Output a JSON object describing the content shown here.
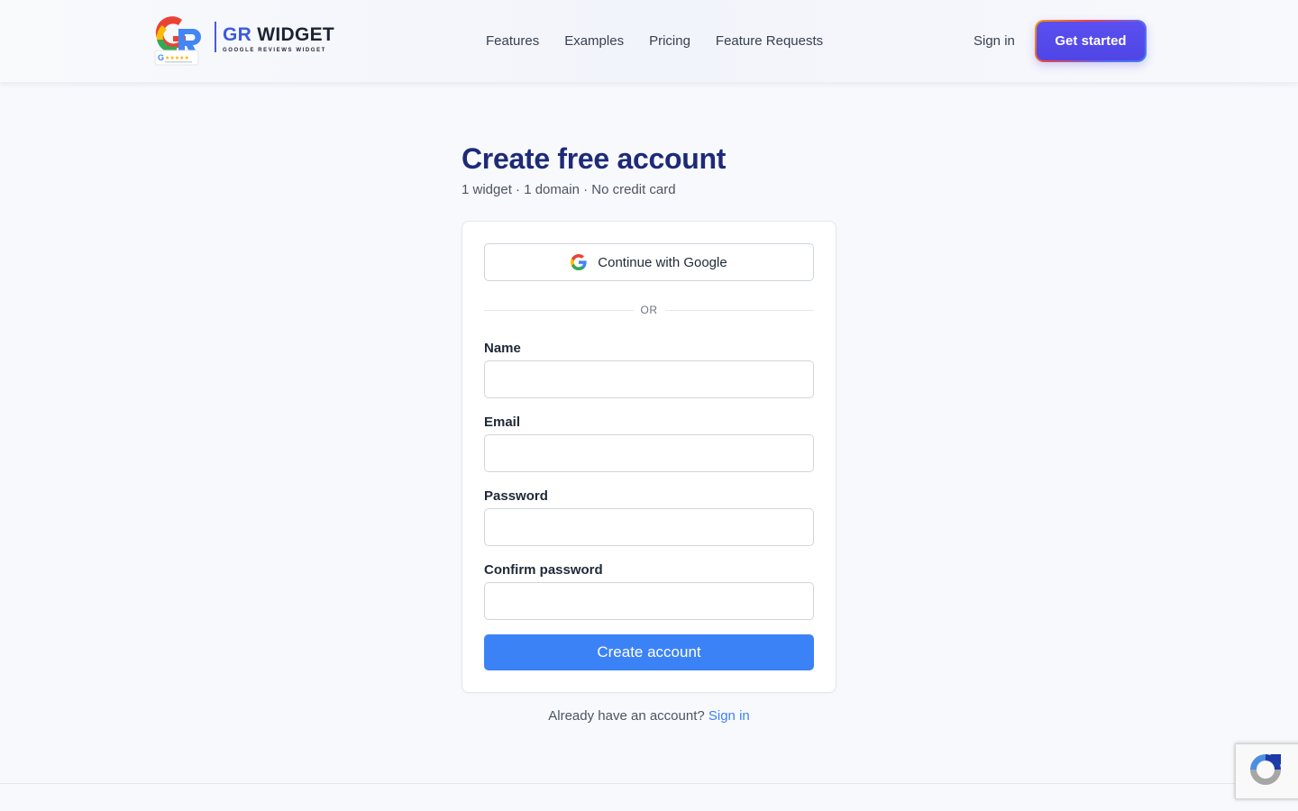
{
  "brand": {
    "name_prefix": "GR",
    "name_suffix": " WIDGET",
    "tagline": "GOOGLE REVIEWS WIDGET"
  },
  "nav": {
    "items": [
      "Features",
      "Examples",
      "Pricing",
      "Feature Requests"
    ],
    "sign_in": "Sign in",
    "get_started": "Get started"
  },
  "page": {
    "title": "Create free account",
    "subtitle": "1 widget · 1 domain · No credit card"
  },
  "form": {
    "google_button": "Continue with Google",
    "divider": "OR",
    "fields": [
      {
        "label": "Name",
        "value": "",
        "placeholder": ""
      },
      {
        "label": "Email",
        "value": "",
        "placeholder": ""
      },
      {
        "label": "Password",
        "value": "",
        "placeholder": ""
      },
      {
        "label": "Confirm password",
        "value": "",
        "placeholder": ""
      }
    ],
    "submit": "Create account"
  },
  "footer": {
    "prompt": "Already have an account? ",
    "sign_in_link": "Sign in"
  },
  "icons": {
    "logo": "gr-logo-icon",
    "google": "google-icon",
    "recaptcha": "recaptcha-icon"
  },
  "colors": {
    "title": "#1e2a78",
    "primary_button": "#3b82f6",
    "cta": "#4f46e5",
    "link": "#3b82f6"
  }
}
